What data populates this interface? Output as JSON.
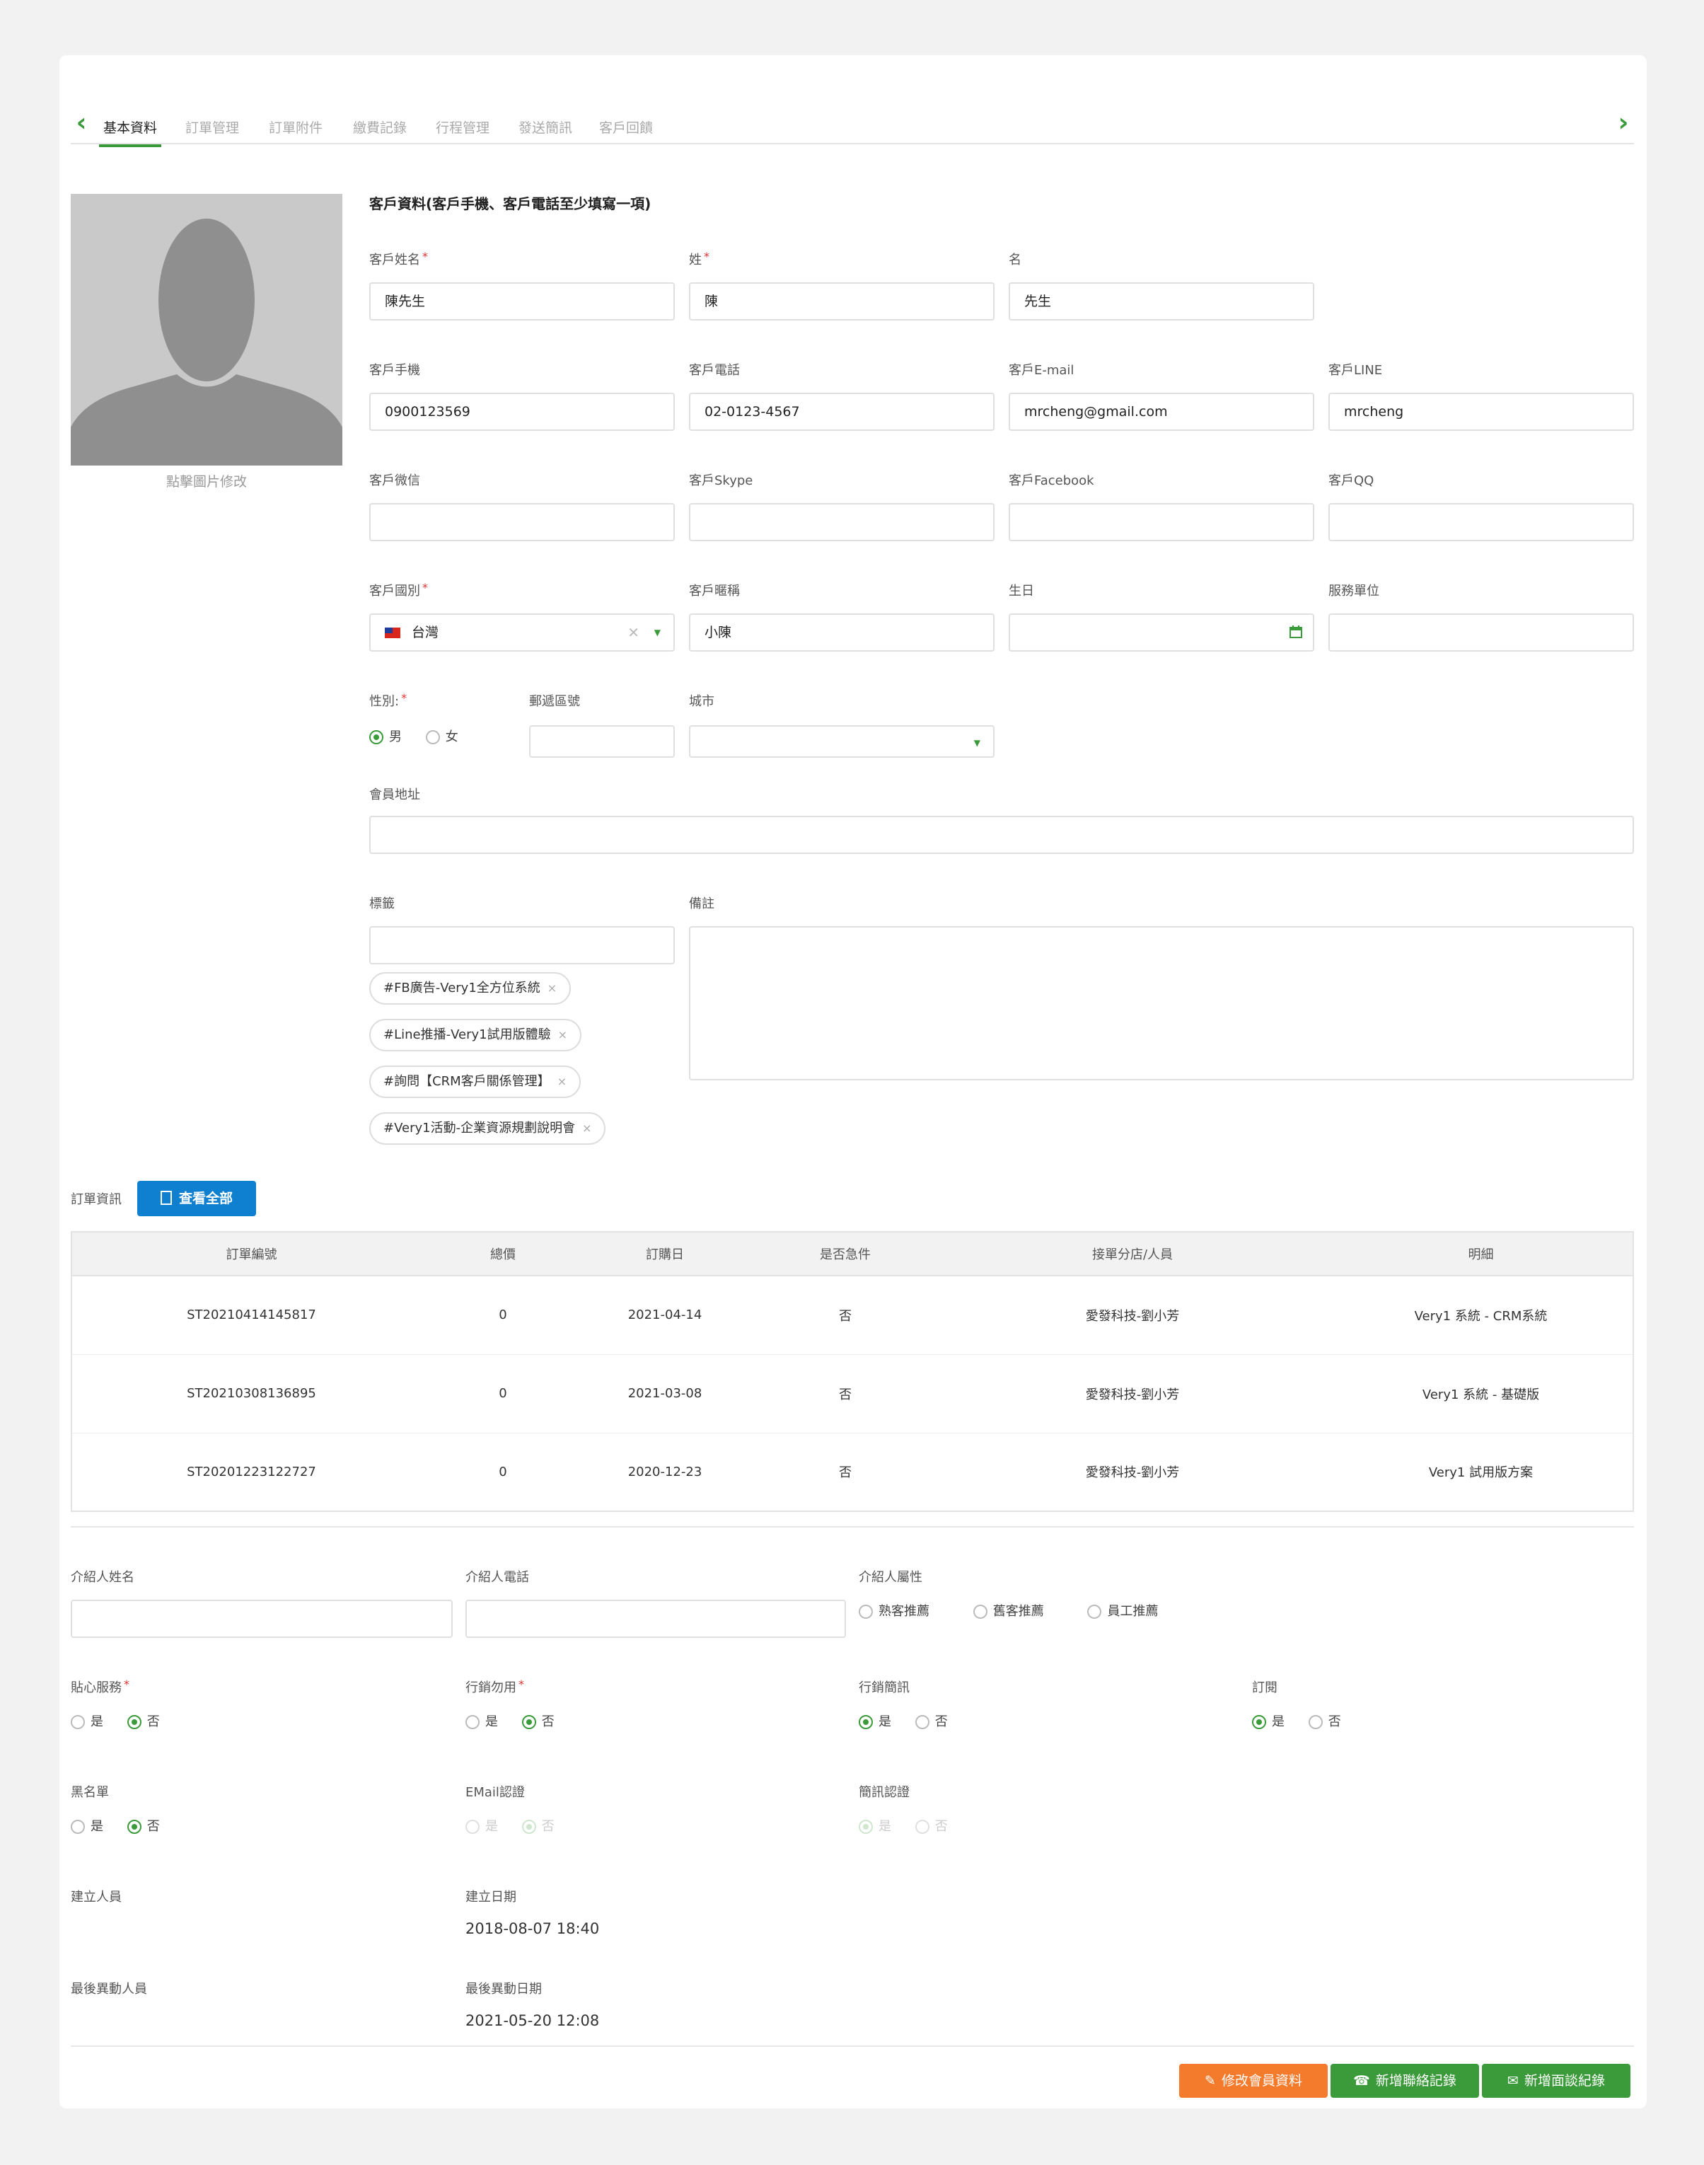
{
  "tabs": {
    "items": [
      "基本資料",
      "訂單管理",
      "訂單附件",
      "繳費記錄",
      "行程管理",
      "發送簡訊",
      "客戶回饋"
    ],
    "active": "基本資料"
  },
  "avatar": {
    "caption": "點擊圖片修改"
  },
  "form": {
    "section_title": "客戶資料(客戶手機、客戶電話至少填寫一項)",
    "customer_name": {
      "label": "客戶姓名",
      "value": "陳先生"
    },
    "last_name": {
      "label": "姓",
      "value": "陳"
    },
    "first_name": {
      "label": "名",
      "value": "先生"
    },
    "mobile": {
      "label": "客戶手機",
      "value": "0900123569"
    },
    "phone": {
      "label": "客戶電話",
      "value": "02-0123-4567"
    },
    "email": {
      "label": "客戶E-mail",
      "value": "mrcheng@gmail.com"
    },
    "line": {
      "label": "客戶LINE",
      "value": "mrcheng"
    },
    "wechat": {
      "label": "客戶微信",
      "value": ""
    },
    "skype": {
      "label": "客戶Skype",
      "value": ""
    },
    "facebook": {
      "label": "客戶Facebook",
      "value": ""
    },
    "qq": {
      "label": "客戶QQ",
      "value": ""
    },
    "country": {
      "label": "客戶國別",
      "value": "台灣"
    },
    "nickname": {
      "label": "客戶暱稱",
      "value": "小陳"
    },
    "birthday": {
      "label": "生日",
      "value": ""
    },
    "company": {
      "label": "服務單位",
      "value": ""
    },
    "gender": {
      "label": "性別:",
      "options": [
        "男",
        "女"
      ],
      "selected": "男"
    },
    "zipcode": {
      "label": "郵遞區號",
      "value": ""
    },
    "city": {
      "label": "城市",
      "value": ""
    },
    "address": {
      "label": "會員地址",
      "value": ""
    },
    "tags": {
      "label": "標籤",
      "input": "",
      "items": [
        "#FB廣告-Very1全方位系統",
        "#Line推播-Very1試用版體驗",
        "#詢問【CRM客戶關係管理】",
        "#Very1活動-企業資源規劃說明會"
      ],
      "remove": "×"
    },
    "note": {
      "label": "備註",
      "value": ""
    }
  },
  "orders": {
    "label": "訂單資訊",
    "view_all": "查看全部",
    "columns": [
      "訂單編號",
      "總價",
      "訂購日",
      "是否急件",
      "接單分店/人員",
      "明細"
    ],
    "rows": [
      [
        "ST20210414145817",
        "0",
        "2021-04-14",
        "否",
        "愛發科技-劉小芳",
        "Very1 系統 - CRM系統"
      ],
      [
        "ST20210308136895",
        "0",
        "2021-03-08",
        "否",
        "愛發科技-劉小芳",
        "Very1 系統 - 基礎版"
      ],
      [
        "ST20201223122727",
        "0",
        "2020-12-23",
        "否",
        "愛發科技-劉小芳",
        "Very1 試用版方案"
      ]
    ]
  },
  "referral": {
    "name": {
      "label": "介紹人姓名",
      "value": ""
    },
    "phone": {
      "label": "介紹人電話",
      "value": ""
    },
    "type": {
      "label": "介紹人屬性",
      "options": [
        "熟客推薦",
        "舊客推薦",
        "員工推薦"
      ]
    }
  },
  "settings": {
    "care_service": {
      "label": "貼心服務",
      "options": [
        "是",
        "否"
      ],
      "selected": "否"
    },
    "marketing_disabled": {
      "label": "行銷勿用",
      "options": [
        "是",
        "否"
      ],
      "selected": "否"
    },
    "marketing_sms": {
      "label": "行銷簡訊",
      "options": [
        "是",
        "否"
      ],
      "selected": "是"
    },
    "subscribe": {
      "label": "訂閱",
      "options": [
        "是",
        "否"
      ],
      "selected": "是"
    },
    "blacklist": {
      "label": "黑名單",
      "options": [
        "是",
        "否"
      ],
      "selected": "否"
    },
    "email_verify": {
      "label": "EMail認證",
      "options": [
        "是",
        "否"
      ],
      "selected": "否"
    },
    "sms_verify": {
      "label": "簡訊認證",
      "options": [
        "是",
        "否"
      ],
      "selected": "是"
    }
  },
  "meta": {
    "created_by": {
      "label": "建立人員",
      "value": ""
    },
    "created_at": {
      "label": "建立日期",
      "value": "2018-08-07 18:40"
    },
    "updated_by": {
      "label": "最後異動人員",
      "value": ""
    },
    "updated_at": {
      "label": "最後異動日期",
      "value": "2021-05-20 12:08"
    }
  },
  "actions": {
    "edit": "修改會員資料",
    "add_contact": "新增聯絡記錄",
    "add_meeting": "新增面談紀錄"
  },
  "colors": {
    "accent_green": "#3b9b3a",
    "blue": "#0f7fcf",
    "orange": "#f47a2c",
    "required": "#d33333"
  }
}
